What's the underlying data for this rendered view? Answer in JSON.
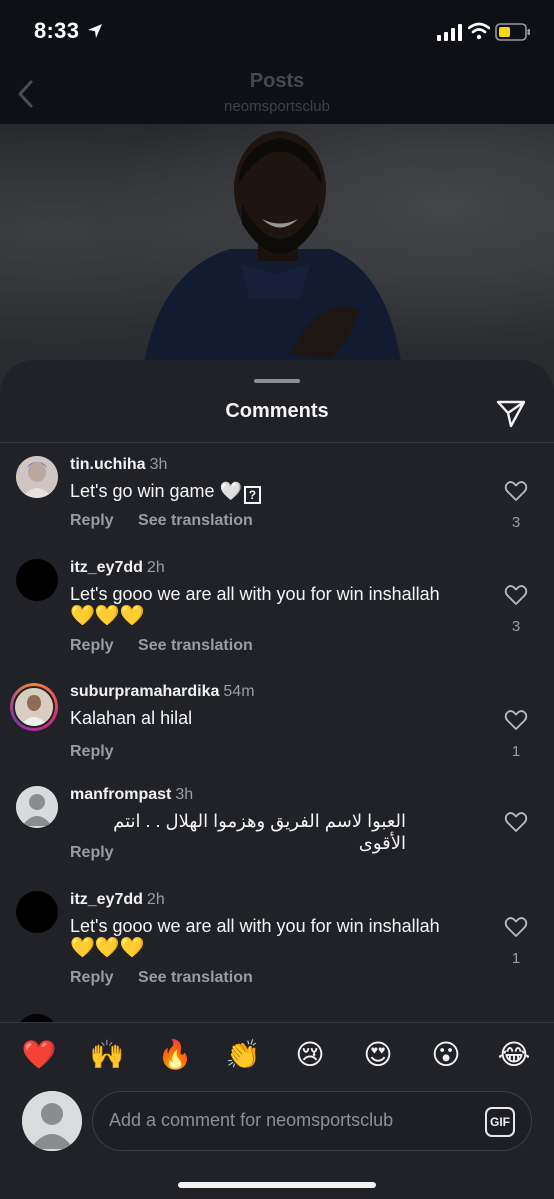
{
  "status_bar": {
    "time": "8:33"
  },
  "header": {
    "title": "Posts",
    "subtitle": "neomsportsclub"
  },
  "sheet": {
    "title": "Comments"
  },
  "comments": [
    {
      "username": "tin.uchiha",
      "time": "3h",
      "text": "Let's go win game 🤍",
      "actions": [
        "Reply",
        "See translation"
      ],
      "likes": "3"
    },
    {
      "username": "itz_ey7dd",
      "time": "2h",
      "text": "Let's gooo we are all with you for win inshallah",
      "emoji": "💛💛💛",
      "actions": [
        "Reply",
        "See translation"
      ],
      "likes": "3"
    },
    {
      "username": "suburpramahardika",
      "time": "54m",
      "text": "Kalahan al hilal",
      "actions": [
        "Reply"
      ],
      "likes": "1"
    },
    {
      "username": "manfrompast",
      "time": "3h",
      "text": "العبوا لاسم الفريق وهزموا الهلال . . انتم الأقوى",
      "actions": [
        "Reply"
      ],
      "likes": ""
    },
    {
      "username": "itz_ey7dd",
      "time": "2h",
      "text": "Let's gooo we are all with you for win inshallah",
      "emoji": "💛💛💛",
      "actions": [
        "Reply",
        "See translation"
      ],
      "likes": "1"
    }
  ],
  "emoji_bar": [
    "❤️",
    "🙌",
    "🔥",
    "👏",
    "😢",
    "😍",
    "😮",
    "😂"
  ],
  "composer": {
    "placeholder": "Add a comment for neomsportsclub",
    "gif_label": "GIF"
  }
}
